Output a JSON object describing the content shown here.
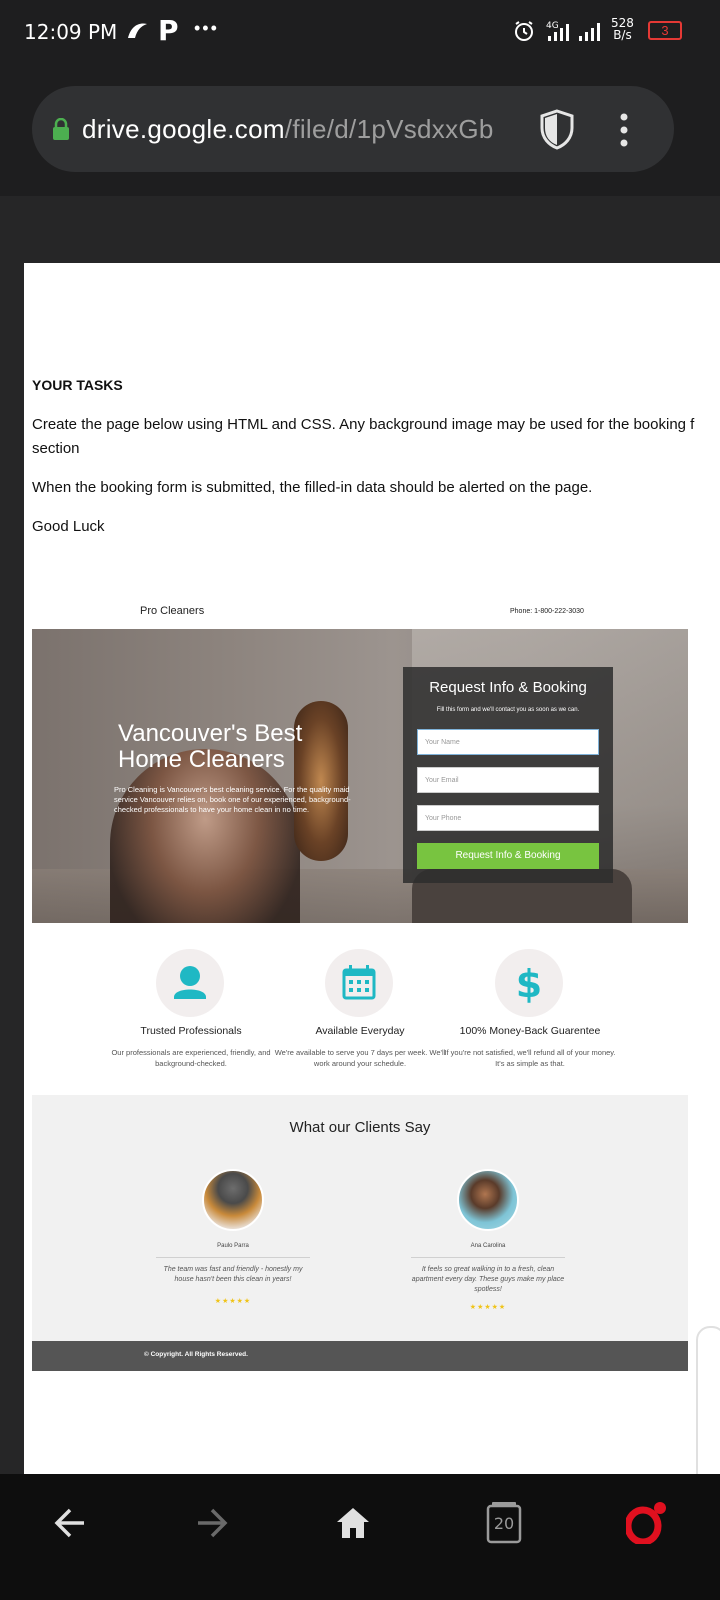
{
  "status_bar": {
    "time": "12:09 PM",
    "app_p": "P",
    "more": "•••",
    "network": "4G",
    "speed_value": "528",
    "speed_unit": "B/s",
    "battery": "3"
  },
  "browser": {
    "url_domain": "drive.google.com",
    "url_path": "/file/d/1pVsdxxGb"
  },
  "document": {
    "heading": "YOUR TASKS",
    "line1": "Create the page below using HTML and CSS. Any background image may be used for the booking f",
    "line1b": "section",
    "line2": "When the booking form is submitted, the filled-in data should be alerted on the page.",
    "line3": "Good Luck"
  },
  "mockup": {
    "brand": "Pro Cleaners",
    "phone": "Phone: 1-800-222-3030",
    "hero_title_1": "Vancouver's Best",
    "hero_title_2": "Home Cleaners",
    "hero_copy": "Pro Cleaning is Vancouver's best cleaning service. For the quality maid service Vancouver relies on, book one of our experienced, background-checked professionals to have your home clean in no time.",
    "form": {
      "title": "Request Info & Booking",
      "subtitle": "Fill this form and we'll contact you as soon as we can.",
      "name_placeholder": "Your Name",
      "email_placeholder": "Your Email",
      "phone_placeholder": "Your Phone",
      "button": "Request Info & Booking"
    },
    "features": [
      {
        "icon": "person-icon",
        "title": "Trusted Professionals",
        "text": "Our professionals are experienced, friendly, and background-checked."
      },
      {
        "icon": "calendar-icon",
        "title": "Available Everyday",
        "text": "We're available to serve you 7 days per week. We'll work around your schedule."
      },
      {
        "icon": "dollar-icon",
        "title": "100% Money-Back Guarentee",
        "text": "If you're not satisfied, we'll refund all of your money. It's as simple as that."
      }
    ],
    "testimonials_title": "What our Clients Say",
    "testimonials": [
      {
        "name": "Paulo Parra",
        "quote": "The team was fast and friendly - honestly my house hasn't been this clean in years!",
        "stars": "★★★★★"
      },
      {
        "name": "Ana Carolina",
        "quote": "It feels so great walking in to a fresh, clean apartment every day. These guys make my place spotless!",
        "stars": "★★★★★"
      }
    ],
    "footer": "© Copyright. All Rights Reserved."
  },
  "nav": {
    "tab_count": "20"
  },
  "colors": {
    "accent_green": "#78c440",
    "teal_icon": "#1fb8c4",
    "battery_red": "#e53935",
    "opera_red": "#e0101f"
  }
}
